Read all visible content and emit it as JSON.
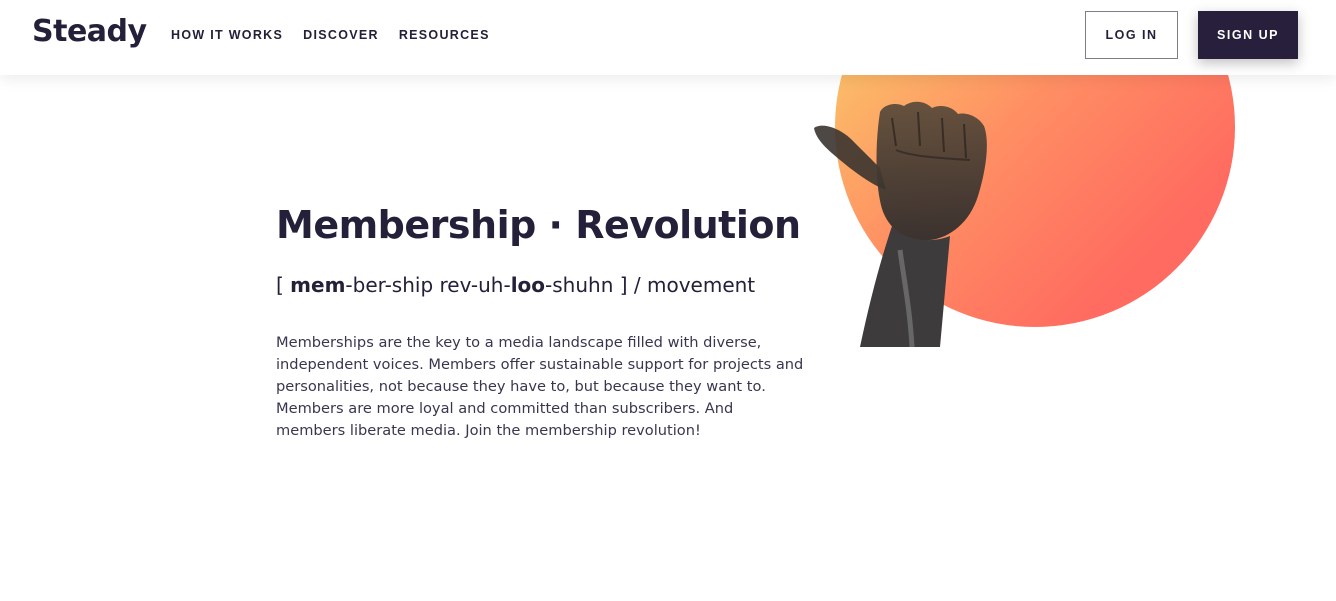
{
  "header": {
    "logo": "Steady",
    "nav": [
      {
        "label": "HOW IT WORKS"
      },
      {
        "label": "DISCOVER"
      },
      {
        "label": "RESOURCES"
      }
    ],
    "login_label": "LOG IN",
    "signup_label": "SIGN UP"
  },
  "hero": {
    "title": "Membership · Revolution",
    "pronunciation": {
      "open": "[ ",
      "bold1": "mem",
      "part2": "-ber-ship rev-uh-",
      "bold2": "loo",
      "part3": "-shuhn ] / movement"
    },
    "body": "Memberships are the key to a media landscape filled with diverse, independent voices. Members offer sustainable support for projects and personalities, not because they have to, but because they want to. Members are more loyal and committed than subscribers. And members liberate media. Join the membership revolution!"
  },
  "colors": {
    "brand_dark": "#271f3b",
    "gradient_start": "#f9d36a",
    "gradient_end": "#ff6b60"
  }
}
